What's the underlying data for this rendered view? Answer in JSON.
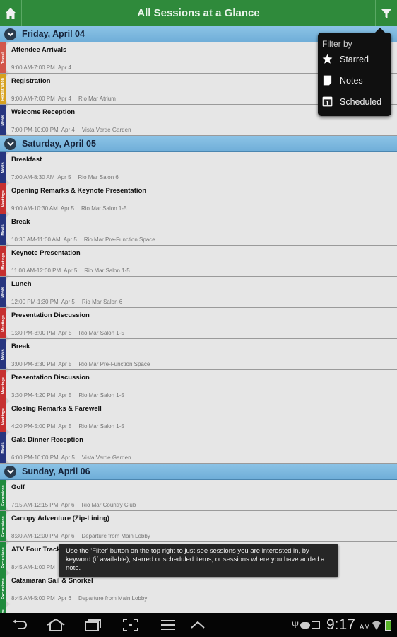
{
  "header": {
    "title": "All Sessions at a Glance",
    "home_icon": "home-icon",
    "filter_icon": "filter-icon",
    "color": "#2f8a3b"
  },
  "tag_colors": {
    "Travel": "#d2564b",
    "Registration": "#d6a11f",
    "Meals": "#27357f",
    "Meetings": "#c62f2f",
    "Excursions": "#1f8a3c"
  },
  "days": [
    {
      "label": "Friday, April 04",
      "sessions": [
        {
          "title": "Attendee Arrivals",
          "time": "9:00 AM-7:00 PM",
          "date": "Apr 4",
          "location": "",
          "tag": "Travel"
        },
        {
          "title": "Registration",
          "time": "9:00 AM-7:00 PM",
          "date": "Apr 4",
          "location": "Rio Mar Atrium",
          "tag": "Registration"
        },
        {
          "title": "Welcome Reception",
          "time": "7:00 PM-10:00 PM",
          "date": "Apr 4",
          "location": "Vista Verde Garden",
          "tag": "Meals"
        }
      ]
    },
    {
      "label": "Saturday, April 05",
      "sessions": [
        {
          "title": "Breakfast",
          "time": "7:00 AM-8:30 AM",
          "date": "Apr 5",
          "location": "Rio Mar Salon 6",
          "tag": "Meals"
        },
        {
          "title": "Opening Remarks & Keynote Presentation",
          "time": "9:00 AM-10:30 AM",
          "date": "Apr 5",
          "location": "Rio Mar Salon 1-5",
          "tag": "Meetings"
        },
        {
          "title": "Break",
          "time": "10:30 AM-11:00 AM",
          "date": "Apr 5",
          "location": "Rio Mar Pre-Function Space",
          "tag": "Meals"
        },
        {
          "title": "Keynote Presentation",
          "time": "11:00 AM-12:00 PM",
          "date": "Apr 5",
          "location": "Rio Mar Salon 1-5",
          "tag": "Meetings"
        },
        {
          "title": "Lunch",
          "time": "12:00 PM-1:30 PM",
          "date": "Apr 5",
          "location": "Rio Mar Salon 6",
          "tag": "Meals"
        },
        {
          "title": "Presentation Discussion",
          "time": "1:30 PM-3:00 PM",
          "date": "Apr 5",
          "location": "Rio Mar Salon 1-5",
          "tag": "Meetings"
        },
        {
          "title": "Break",
          "time": "3:00 PM-3:30 PM",
          "date": "Apr 5",
          "location": "Rio Mar Pre-Function Space",
          "tag": "Meals"
        },
        {
          "title": "Presentation Discussion",
          "time": "3:30 PM-4:20 PM",
          "date": "Apr 5",
          "location": "Rio Mar Salon 1-5",
          "tag": "Meetings"
        },
        {
          "title": "Closing Remarks & Farewell",
          "time": "4:20 PM-5:00 PM",
          "date": "Apr 5",
          "location": "Rio Mar Salon 1-5",
          "tag": "Meetings"
        },
        {
          "title": "Gala Dinner Reception",
          "time": "6:00 PM-10:00 PM",
          "date": "Apr 5",
          "location": "Vista Verde Garden",
          "tag": "Meals"
        }
      ]
    },
    {
      "label": "Sunday, April 06",
      "sessions": [
        {
          "title": "Golf",
          "time": "7:15 AM-12:15 PM",
          "date": "Apr 6",
          "location": "Rio Mar Country Club",
          "tag": "Excursions"
        },
        {
          "title": "Canopy Adventure (Zip-Lining)",
          "time": "8:30 AM-12:00 PM",
          "date": "Apr 6",
          "location": "Departure from Main Lobby",
          "tag": "Excursions"
        },
        {
          "title": "ATV Four Track",
          "time": "8:45 AM-1:00 PM",
          "date": "",
          "location": "",
          "tag": "Excursions"
        },
        {
          "title": "Catamaran Sail & Snorkel",
          "time": "8:45 AM-5:00 PM",
          "date": "Apr 6",
          "location": "Departure from Main Lobby",
          "tag": "Excursions"
        },
        {
          "title": "",
          "time": "",
          "date": "",
          "location": "",
          "tag": "Excursions"
        }
      ]
    }
  ],
  "filter_menu": {
    "heading": "Filter by",
    "items": [
      {
        "label": "Starred",
        "icon": "star-icon"
      },
      {
        "label": "Notes",
        "icon": "note-icon"
      },
      {
        "label": "Scheduled",
        "icon": "calendar-icon"
      }
    ]
  },
  "tooltip": "Use the 'Filter' button on the top right to just see sessions you are interested in, by keyword (if available), starred or scheduled items, or sessions where you have added a note.",
  "status": {
    "time": "9:17",
    "ampm": "AM"
  }
}
